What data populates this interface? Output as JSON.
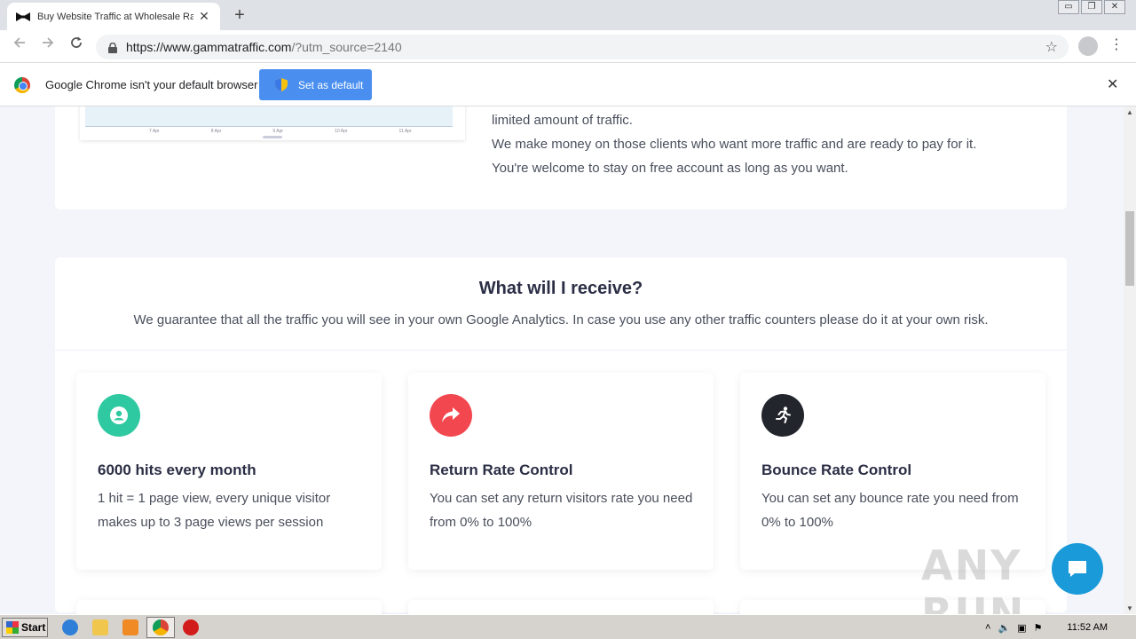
{
  "browser": {
    "tab_title": "Buy Website Traffic at Wholesale Ra",
    "tab_close": "✕",
    "new_tab": "+",
    "url_host": "https://www.gammatraffic.com",
    "url_rest": "/?utm_source=2140",
    "window_controls": [
      "▭",
      "❐",
      "✕"
    ]
  },
  "infobar": {
    "message": "Google Chrome isn't your default browser",
    "button_label": "Set as default",
    "close": "✕"
  },
  "top_section": {
    "chart_ticks": [
      "7 Apr",
      "8 Apr",
      "9 Apr",
      "10 Apr",
      "11 Apr"
    ],
    "lines": [
      "limited amount of traffic.",
      "We make money on those clients who want more traffic and are ready to pay for it.",
      "You're welcome to stay on free account as long as you want."
    ]
  },
  "receive": {
    "heading": "What will I receive?",
    "subheading": "We guarantee that all the traffic you will see in your own Google Analytics. In case you use any other traffic counters please do it at your own risk.",
    "features": [
      {
        "icon": "user-icon",
        "color": "#2fc9a1",
        "title": "6000 hits every month",
        "desc": "1 hit = 1 page view, every unique visitor makes up to 3 page views per session"
      },
      {
        "icon": "share-arrow-icon",
        "color": "#f2474f",
        "title": "Return Rate Control",
        "desc": "You can set any return visitors rate you need from 0% to 100%"
      },
      {
        "icon": "runner-icon",
        "color": "#22252b",
        "title": "Bounce Rate Control",
        "desc": "You can set any bounce rate you need from 0% to 100%"
      }
    ]
  },
  "watermark": "ANY RUN",
  "taskbar": {
    "start_label": "Start",
    "clock": "11:52 AM"
  }
}
